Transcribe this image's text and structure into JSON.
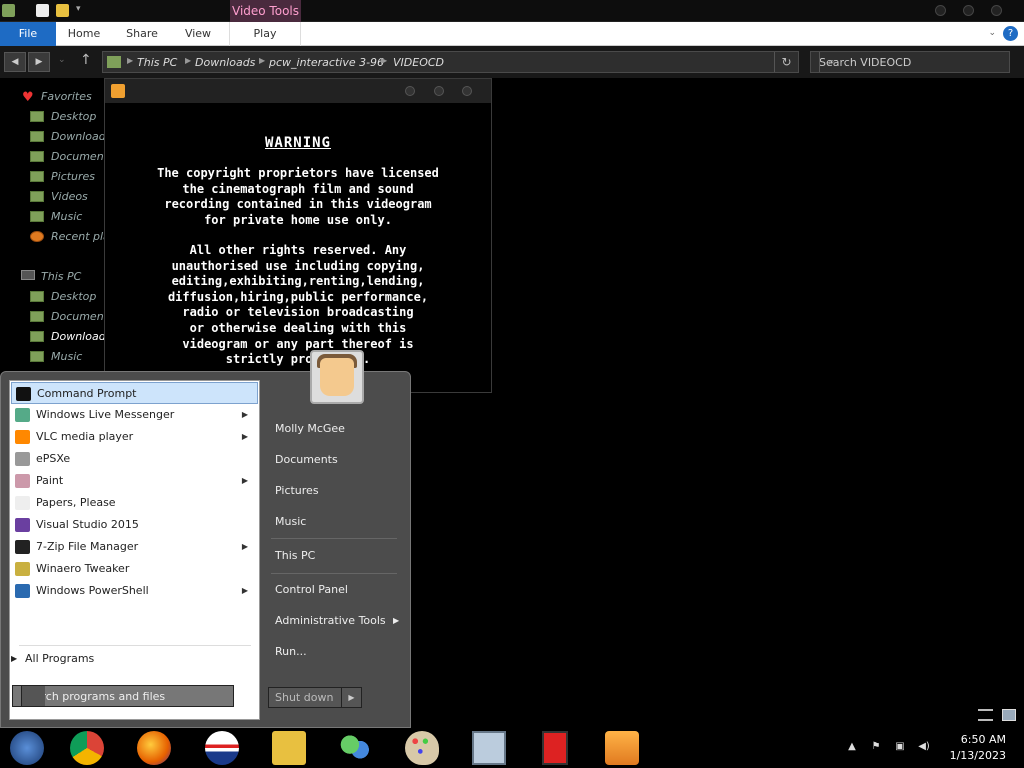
{
  "explorer": {
    "contextual_tab": "Video Tools",
    "tabs": [
      "File",
      "Home",
      "Share",
      "View",
      "Play"
    ],
    "help": "?",
    "breadcrumb": [
      "This PC",
      "Downloads",
      "pcw_interactive 3-96",
      "VIDEOCD"
    ],
    "search_placeholder": "Search VIDEOCD",
    "nav": {
      "favorites_header": "Favorites",
      "favorites": [
        "Desktop",
        "Downloads",
        "Documents",
        "Pictures",
        "Videos",
        "Music",
        "Recent places"
      ],
      "thispc_header": "This PC",
      "thispc": [
        "Desktop",
        "Documents",
        "Downloads",
        "Music"
      ]
    }
  },
  "video": {
    "heading": "WARNING",
    "para1": "The copyright proprietors have licensed\nthe cinematograph film and sound\nrecording contained in this videogram\nfor private home use only.",
    "para2": "All other rights reserved. Any\nunauthorised use including copying,\nediting,exhibiting,renting,lending,\ndiffusion,hiring,public performance,\nradio or television broadcasting\nor otherwise dealing with this\nvideogram or any part thereof is\nstrictly prohibited."
  },
  "start_menu": {
    "programs": [
      {
        "label": "Command Prompt",
        "icon": "cmd-icon",
        "submenu": false,
        "selected": true
      },
      {
        "label": "Windows Live Messenger",
        "icon": "messenger-icon",
        "submenu": true
      },
      {
        "label": "VLC media player",
        "icon": "vlc-icon",
        "submenu": true
      },
      {
        "label": "ePSXe",
        "icon": "gamepad-icon",
        "submenu": false
      },
      {
        "label": "Paint",
        "icon": "paint-icon",
        "submenu": true
      },
      {
        "label": "Papers, Please",
        "icon": "document-icon",
        "submenu": false
      },
      {
        "label": "Visual Studio 2015",
        "icon": "visual-studio-icon",
        "submenu": false
      },
      {
        "label": "7-Zip File Manager",
        "icon": "7zip-icon",
        "submenu": true
      },
      {
        "label": "Winaero Tweaker",
        "icon": "tweaker-icon",
        "submenu": false
      },
      {
        "label": "Windows PowerShell",
        "icon": "powershell-icon",
        "submenu": true
      }
    ],
    "all_programs": "All Programs",
    "search_placeholder": "Search programs and files",
    "right_links": [
      "Molly McGee",
      "Documents",
      "Pictures",
      "Music",
      "This PC",
      "Control Panel",
      "Administrative Tools",
      "Run..."
    ],
    "shutdown": "Shut down"
  },
  "taskbar": {
    "time": "6:50 AM",
    "date": "1/13/2023",
    "pinned": [
      "start-orb-icon",
      "chrome-icon",
      "firefox-icon",
      "obama-logo-icon",
      "file-explorer-icon",
      "messenger-icon",
      "paint-icon",
      "network-files-icon",
      "red-app-icon",
      "media-player-icon"
    ]
  },
  "colors": {
    "accent": "#1e6bc4",
    "video_tools": "#ff9fcf",
    "selection": "#cde4fb"
  }
}
